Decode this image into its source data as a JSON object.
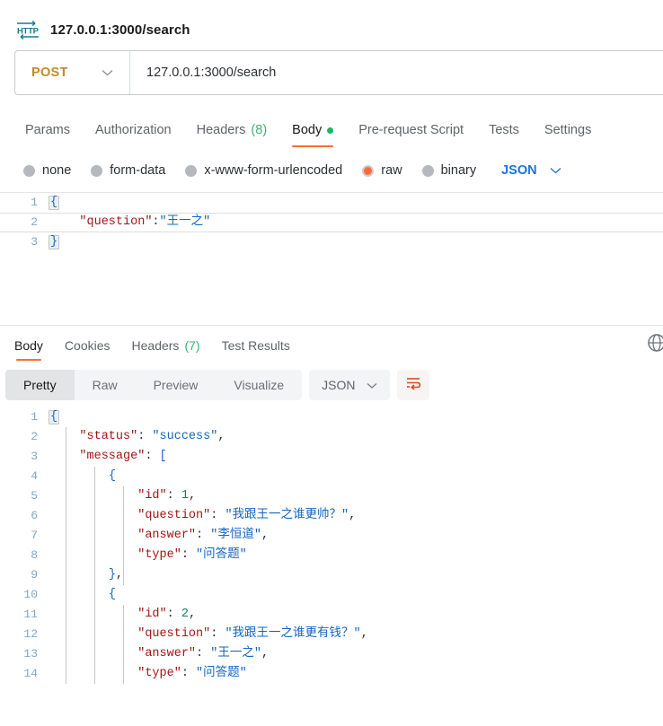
{
  "titlebar": {
    "icon": "http-icon",
    "title": "127.0.0.1:3000/search"
  },
  "urlbar": {
    "method": "POST",
    "method_chevron": "chevron-down-icon",
    "url": "127.0.0.1:3000/search"
  },
  "request_tabs": [
    {
      "label": "Params",
      "active": false
    },
    {
      "label": "Authorization",
      "active": false
    },
    {
      "label": "Headers",
      "count": "(8)",
      "active": false
    },
    {
      "label": "Body",
      "active": true,
      "dot": true
    },
    {
      "label": "Pre-request Script",
      "active": false
    },
    {
      "label": "Tests",
      "active": false
    },
    {
      "label": "Settings",
      "active": false
    }
  ],
  "body_types": [
    {
      "label": "none",
      "selected": false
    },
    {
      "label": "form-data",
      "selected": false
    },
    {
      "label": "x-www-form-urlencoded",
      "selected": false
    },
    {
      "label": "raw",
      "selected": true
    },
    {
      "label": "binary",
      "selected": false
    }
  ],
  "body_format": {
    "value": "JSON",
    "chevron": "chevron-down-icon"
  },
  "request_body": {
    "lines": [
      {
        "no": "1",
        "text": "{"
      },
      {
        "no": "2",
        "text": "    \"question\":\"王一之\""
      },
      {
        "no": "3",
        "text": "}"
      }
    ],
    "active_line": 2,
    "raw": "{\n    \"question\":\"王一之\"\n}"
  },
  "response_tabs": [
    {
      "label": "Body",
      "active": true
    },
    {
      "label": "Cookies",
      "active": false
    },
    {
      "label": "Headers",
      "count": "(7)",
      "active": false
    },
    {
      "label": "Test Results",
      "active": false
    }
  ],
  "response_toolbar": {
    "views": [
      {
        "label": "Pretty",
        "active": true
      },
      {
        "label": "Raw",
        "active": false
      },
      {
        "label": "Preview",
        "active": false
      },
      {
        "label": "Visualize",
        "active": false
      }
    ],
    "format": {
      "value": "JSON",
      "chevron": "chevron-down-icon"
    },
    "wrap_button": "word-wrap-icon",
    "info_icon": "globe-icon"
  },
  "response_body": {
    "lines": [
      {
        "no": "1",
        "text": "{"
      },
      {
        "no": "2",
        "text": "    \"status\": \"success\","
      },
      {
        "no": "3",
        "text": "    \"message\": ["
      },
      {
        "no": "4",
        "text": "        {"
      },
      {
        "no": "5",
        "text": "            \"id\": 1,"
      },
      {
        "no": "6",
        "text": "            \"question\": \"我跟王一之谁更帅？\","
      },
      {
        "no": "7",
        "text": "            \"answer\": \"李恒道\","
      },
      {
        "no": "8",
        "text": "            \"type\": \"问答题\""
      },
      {
        "no": "9",
        "text": "        },"
      },
      {
        "no": "10",
        "text": "        {"
      },
      {
        "no": "11",
        "text": "            \"id\": 2,"
      },
      {
        "no": "12",
        "text": "            \"question\": \"我跟王一之谁更有钱？\","
      },
      {
        "no": "13",
        "text": "            \"answer\": \"王一之\","
      },
      {
        "no": "14",
        "text": "            \"type\": \"问答题\""
      }
    ]
  },
  "colors": {
    "accent": "#ff6c37",
    "method": "#c5892a",
    "link": "#1b72e8",
    "success": "#18b566",
    "key": "#a31515",
    "string": "#1565c0",
    "number": "#098658",
    "gutter": "#7fa8c9"
  }
}
